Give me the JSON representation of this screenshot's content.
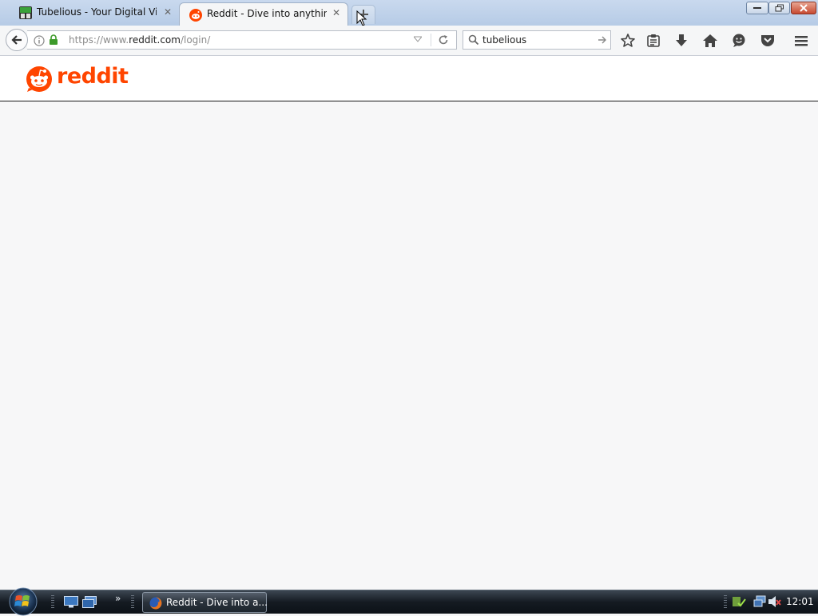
{
  "tabs": [
    {
      "title": "Tubelious - Your Digital Vi...",
      "active": false
    },
    {
      "title": "Reddit - Dive into anything",
      "active": true
    }
  ],
  "navbar": {
    "url_prefix": "https://www.",
    "url_domain": "reddit.com",
    "url_path": "/login/",
    "search_value": "tubelious"
  },
  "page": {
    "wordmark": "reddit",
    "brand_color": "#ff4500"
  },
  "taskbar": {
    "quicklaunch_more": "»",
    "task_label": "Reddit - Dive into a...",
    "clock": "12:01"
  },
  "icons": {
    "toolbar": [
      "bookmark-star-icon",
      "reading-list-icon",
      "downloads-icon",
      "home-icon",
      "hello-chat-icon",
      "pocket-icon",
      "menu-icon"
    ]
  }
}
